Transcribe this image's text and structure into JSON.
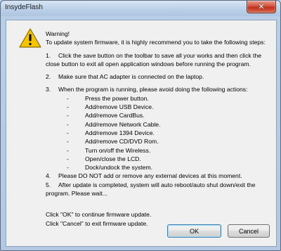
{
  "window": {
    "title": "InsydeFlash",
    "close_glyph": "✕"
  },
  "message": {
    "warning_heading": "Warning!",
    "intro": "To update system firmware, it is highly recommend you to take the following steps:",
    "steps": [
      {
        "num": "1.",
        "lines": [
          "Click the save button on the toolbar to save all your works and then click the",
          "close button to exit all open application windows before running the program."
        ]
      },
      {
        "num": "2.",
        "lines": [
          "Make sure that AC adapter is connected on the laptop."
        ]
      },
      {
        "num": "3.",
        "lines": [
          "When the program is running, please avoid doing the following actions:"
        ]
      },
      {
        "num": "4.",
        "lines": [
          "Please DO NOT add or remove any external devices at this moment."
        ]
      },
      {
        "num": "5.",
        "lines": [
          "After update is completed, system will auto reboot/auto shut down/exit the",
          "program.  Please wait..."
        ]
      }
    ],
    "actions": [
      "Press the power button.",
      "Add/remove USB Device.",
      "Add/remove CardBus.",
      "Add/remove Network Cable.",
      "Add/remove 1394 Device.",
      "Add/remove CD/DVD Rom.",
      "Turn on/off the Wireless.",
      "Open/close the LCD.",
      "Dock/undock the system."
    ],
    "action_dash": "-",
    "ok_hint": "Click \"OK\" to continue firmware update.",
    "cancel_hint": "Click \"Cancel\" to exit firmware update."
  },
  "buttons": {
    "ok": "OK",
    "cancel": "Cancel"
  },
  "icons": {
    "warning": "warning-icon",
    "close": "close-icon"
  },
  "colors": {
    "warning_fill": "#f5c400",
    "close_button": "#c1301b",
    "dialog_bg": "#f0f0f0"
  }
}
